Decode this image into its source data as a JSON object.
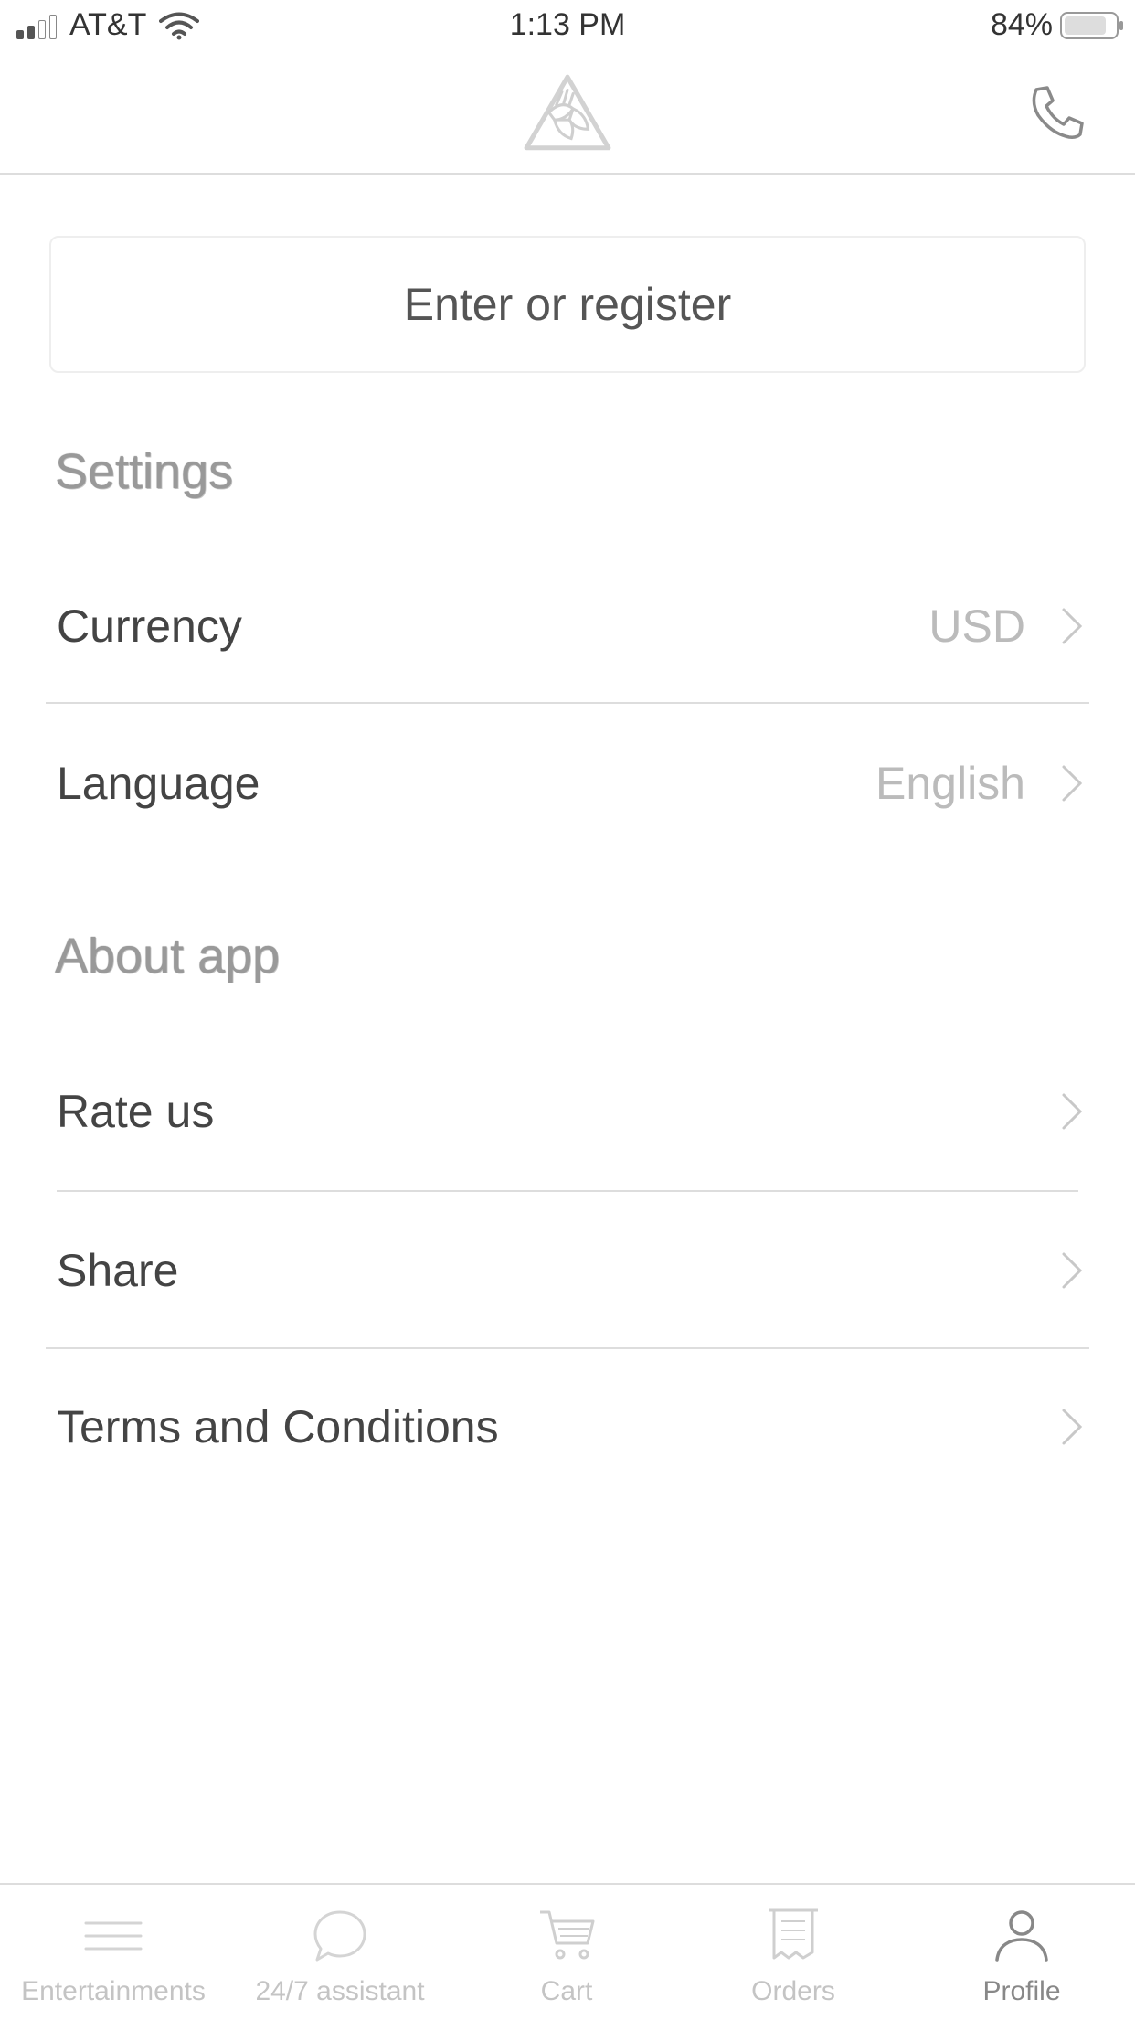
{
  "status_bar": {
    "carrier": "AT&T",
    "time": "1:13 PM",
    "battery": "84%",
    "battery_level": 0.84
  },
  "header": {
    "logo_icon": "hands-triangle-logo",
    "phone_icon": "phone-icon"
  },
  "register_button": {
    "label": "Enter or register"
  },
  "settings": {
    "title": "Settings",
    "items": [
      {
        "label": "Currency",
        "value": "USD"
      },
      {
        "label": "Language",
        "value": "English"
      }
    ]
  },
  "about": {
    "title": "About app",
    "items": [
      {
        "label": "Rate us"
      },
      {
        "label": "Share"
      },
      {
        "label": "Terms and Conditions"
      }
    ]
  },
  "tabbar": {
    "tabs": [
      {
        "label": "Entertainments",
        "icon": "menu-lines-icon"
      },
      {
        "label": "24/7 assistant",
        "icon": "chat-bubble-icon"
      },
      {
        "label": "Cart",
        "icon": "cart-icon"
      },
      {
        "label": "Orders",
        "icon": "receipt-icon"
      },
      {
        "label": "Profile",
        "icon": "person-icon",
        "active": true
      }
    ]
  }
}
